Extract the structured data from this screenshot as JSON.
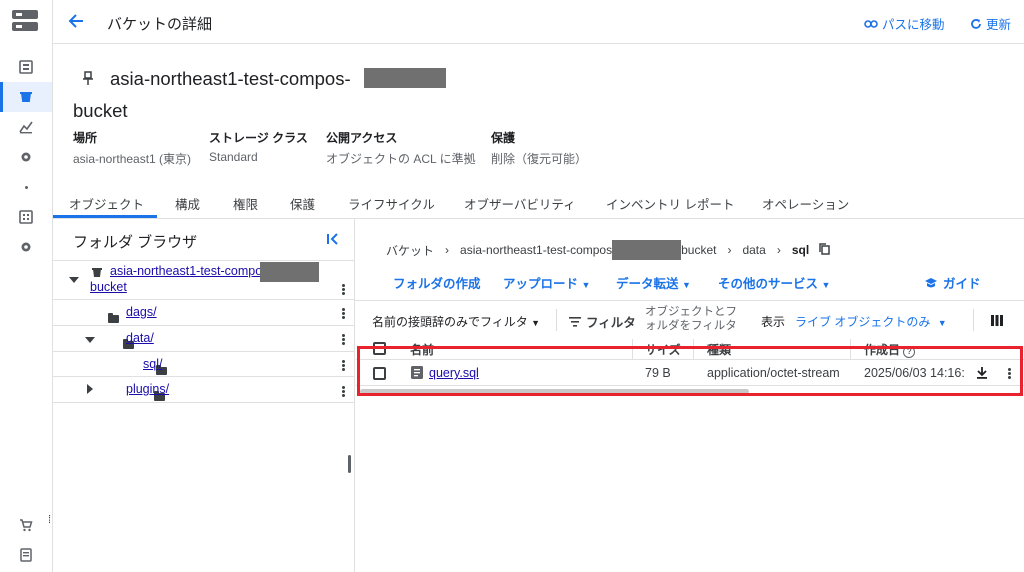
{
  "header": {
    "page_title": "バケットの詳細",
    "goto_path_label": "パスに移動",
    "refresh_label": "更新"
  },
  "bucket": {
    "name_prefix": "asia-northeast1-test-compos-",
    "name_suffix": "bucket",
    "info": [
      {
        "label": "場所",
        "value": "asia-northeast1 (東京)"
      },
      {
        "label": "ストレージ クラス",
        "value": "Standard"
      },
      {
        "label": "公開アクセス",
        "value": "オブジェクトの ACL に準拠"
      },
      {
        "label": "保護",
        "value": "削除（復元可能）"
      }
    ]
  },
  "tabs": [
    "オブジェクト",
    "構成",
    "権限",
    "保護",
    "ライフサイクル",
    "オブザーバビリティ",
    "インベントリ レポート",
    "オペレーション"
  ],
  "folder_browser": {
    "title": "フォルダ ブラウザ",
    "root_label": "asia-northeast1-test-compos",
    "root_label_line2": "bucket",
    "items": [
      "dags/",
      "data/",
      "sql/",
      "plugins/"
    ]
  },
  "breadcrumb": {
    "root": "バケット",
    "bucket_prefix": "asia-northeast1-test-compos",
    "bucket_suffix": "bucket",
    "folder1": "data",
    "folder2": "sql"
  },
  "toolbar": {
    "create_folder": "フォルダの作成",
    "upload": "アップロード",
    "transfer": "データ転送",
    "other_services": "その他のサービス",
    "guide": "ガイド"
  },
  "filter": {
    "prefix_filter": "名前の接頭辞のみでフィルタ",
    "filter_label": "フィルタ",
    "filter_hint_line1": "オブジェクトとフ",
    "filter_hint_line2": "ォルダをフィルタ",
    "show_label": "表示",
    "show_value": "ライブ オブジェクトのみ"
  },
  "table": {
    "headers": [
      "名前",
      "サイズ",
      "種類",
      "作成日"
    ],
    "rows": [
      {
        "name": "query.sql",
        "size": "79 B",
        "type": "application/octet-stream",
        "created": "2025/06/03 14:16:"
      }
    ]
  },
  "colors": {
    "accent": "#1a73e8",
    "highlight_border": "#e8232d",
    "link_visited": "#681da8"
  }
}
